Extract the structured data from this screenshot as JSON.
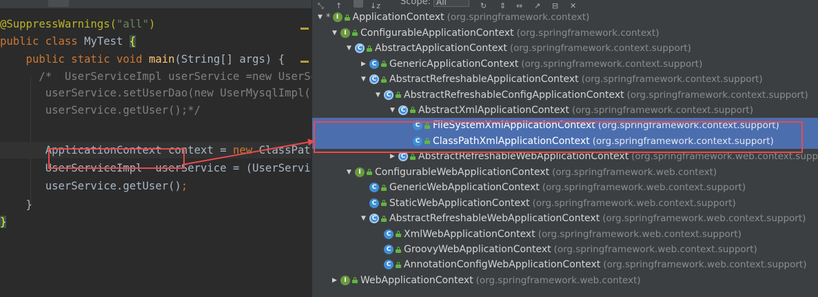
{
  "editor": {
    "lines": [
      {
        "parts": [
          {
            "t": "@SuppressWarnings(",
            "c": "ann"
          },
          {
            "t": "\"",
            "c": "str"
          },
          {
            "t": "all",
            "c": "str"
          },
          {
            "t": "\"",
            "c": "str"
          },
          {
            "t": ")",
            "c": "ann"
          }
        ]
      },
      {
        "parts": [
          {
            "t": "public class ",
            "c": "kw"
          },
          {
            "t": "MyTest ",
            "c": ""
          },
          {
            "t": "{",
            "c": "brace-hl"
          }
        ]
      },
      {
        "parts": [
          {
            "t": "    public static void ",
            "c": "kw"
          },
          {
            "t": "main",
            "c": "fn"
          },
          {
            "t": "(String[] args) {",
            "c": ""
          }
        ]
      },
      {
        "parts": [
          {
            "t": "      /*  UserServiceImpl userService =new UserServiceImpl();",
            "c": "cm"
          }
        ]
      },
      {
        "parts": [
          {
            "t": "       userService.setUserDao(new UserMysqlImpl());",
            "c": "cm"
          }
        ]
      },
      {
        "parts": [
          {
            "t": "       userService.getUser();*/",
            "c": "cm"
          }
        ]
      },
      {
        "parts": [
          {
            "t": "",
            "c": ""
          }
        ]
      },
      {
        "parts": [
          {
            "t": "       ApplicationContext ",
            "c": ""
          },
          {
            "t": "context = ",
            "c": ""
          },
          {
            "t": "new ",
            "c": "kw"
          },
          {
            "t": "ClassPathXmlApplicationContext(",
            "c": ""
          }
        ]
      },
      {
        "parts": [
          {
            "t": "       UserServiceImpl  userService = (UserServiceImpl) context.getBean(",
            "c": ""
          }
        ]
      },
      {
        "parts": [
          {
            "t": "       userService.getUser()",
            "c": ""
          },
          {
            "t": ";",
            "c": "kw"
          }
        ]
      },
      {
        "parts": [
          {
            "t": "    }",
            "c": ""
          }
        ]
      },
      {
        "parts": [
          {
            "t": "}",
            "c": "brace-hl"
          }
        ]
      }
    ]
  },
  "toolbar": {
    "scope_label": "Scope:",
    "scope_value": "All"
  },
  "tree": [
    {
      "depth": 0,
      "toggle": "▼",
      "star": true,
      "icon": "interface",
      "name": "ApplicationContext",
      "pkg": "(org.springframework.context)"
    },
    {
      "depth": 1,
      "toggle": "▼",
      "icon": "interface",
      "name": "ConfigurableApplicationContext",
      "pkg": "(org.springframework.context)"
    },
    {
      "depth": 2,
      "toggle": "▼",
      "icon": "abstract",
      "name": "AbstractApplicationContext",
      "pkg": "(org.springframework.context.support)"
    },
    {
      "depth": 3,
      "toggle": "▶",
      "icon": "class",
      "name": "GenericApplicationContext",
      "pkg": "(org.springframework.context.support)"
    },
    {
      "depth": 3,
      "toggle": "▼",
      "icon": "abstract",
      "name": "AbstractRefreshableApplicationContext",
      "pkg": "(org.springframework.context.support)"
    },
    {
      "depth": 4,
      "toggle": "▼",
      "icon": "abstract",
      "name": "AbstractRefreshableConfigApplicationContext",
      "pkg": "(org.springframework.context.support)"
    },
    {
      "depth": 5,
      "toggle": "▼",
      "icon": "abstract",
      "name": "AbstractXmlApplicationContext",
      "pkg": "(org.springframework.context.support)"
    },
    {
      "depth": 6,
      "toggle": "",
      "icon": "class",
      "name": "FileSystemXmlApplicationContext",
      "pkg": "(org.springframework.context.support)",
      "selected": true
    },
    {
      "depth": 6,
      "toggle": "",
      "icon": "class",
      "name": "ClassPathXmlApplicationContext",
      "pkg": "(org.springframework.context.support)",
      "selected": true
    },
    {
      "depth": 5,
      "toggle": "▶",
      "icon": "abstract",
      "name": "AbstractRefreshableWebApplicationContext",
      "pkg": "(org.springframework.web.context.support)"
    },
    {
      "depth": 2,
      "toggle": "▼",
      "icon": "interface",
      "name": "ConfigurableWebApplicationContext",
      "pkg": "(org.springframework.web.context)"
    },
    {
      "depth": 3,
      "toggle": "",
      "icon": "class",
      "name": "GenericWebApplicationContext",
      "pkg": "(org.springframework.web.context.support)"
    },
    {
      "depth": 3,
      "toggle": "",
      "icon": "class",
      "name": "StaticWebApplicationContext",
      "pkg": "(org.springframework.web.context.support)"
    },
    {
      "depth": 3,
      "toggle": "▼",
      "icon": "abstract",
      "name": "AbstractRefreshableWebApplicationContext",
      "pkg": "(org.springframework.web.context.support)"
    },
    {
      "depth": 4,
      "toggle": "",
      "icon": "class",
      "name": "XmlWebApplicationContext",
      "pkg": "(org.springframework.web.context.support)"
    },
    {
      "depth": 4,
      "toggle": "",
      "icon": "class",
      "name": "GroovyWebApplicationContext",
      "pkg": "(org.springframework.web.context.support)"
    },
    {
      "depth": 4,
      "toggle": "",
      "icon": "class",
      "name": "AnnotationConfigWebApplicationContext",
      "pkg": "(org.springframework.web.context.support)"
    },
    {
      "depth": 1,
      "toggle": "▶",
      "icon": "interface",
      "name": "WebApplicationContext",
      "pkg": "(org.springframework.web.context)"
    }
  ],
  "colors": {
    "editor_bg": "#2b2b2b",
    "panel_bg": "#3c3f41",
    "selection": "#4b6eaf",
    "annotation_red": "#e84b4b"
  }
}
